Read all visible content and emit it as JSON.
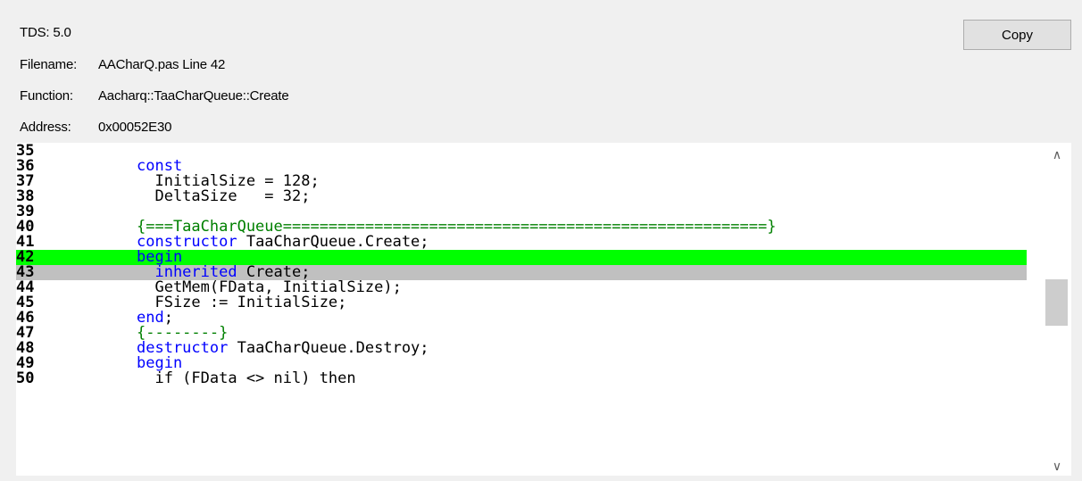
{
  "header": {
    "tds": "TDS: 5.0",
    "filename_label": "Filename:",
    "filename_value": "AACharQ.pas Line 42",
    "function_label": "Function:",
    "function_value": "Aacharq::TaaCharQueue::Create",
    "address_label": "Address:",
    "address_value": "0x00052E30"
  },
  "toolbar": {
    "copy_label": "Copy"
  },
  "code": {
    "highlight_current_line": "42",
    "highlight_secondary_line": "43",
    "colors": {
      "current_line": "#00ff00",
      "secondary_line": "#c0c0c0",
      "keyword": "#0000ff",
      "comment": "#008000"
    },
    "lines": [
      {
        "num": "35",
        "text": ""
      },
      {
        "num": "36",
        "kw1": "const",
        "text": ""
      },
      {
        "num": "37",
        "text": "  InitialSize = 128;"
      },
      {
        "num": "38",
        "text": "  DeltaSize   = 32;"
      },
      {
        "num": "39",
        "text": ""
      },
      {
        "num": "40",
        "comment": "{===TaaCharQueue=====================================================}"
      },
      {
        "num": "41",
        "kw1": "constructor",
        "text": " TaaCharQueue.Create;"
      },
      {
        "num": "42",
        "kw1": "begin",
        "text": ""
      },
      {
        "num": "43",
        "kw1": "  inherited",
        "text": " Create;"
      },
      {
        "num": "44",
        "text": "  GetMem(FData, InitialSize);"
      },
      {
        "num": "45",
        "text": "  FSize := InitialSize;"
      },
      {
        "num": "46",
        "kw1": "end",
        "text": ";"
      },
      {
        "num": "47",
        "comment": "{--------}"
      },
      {
        "num": "48",
        "kw1": "destructor",
        "text": " TaaCharQueue.Destroy;"
      },
      {
        "num": "49",
        "kw1": "begin",
        "text": ""
      },
      {
        "num": "50",
        "text": "  if (FData <> nil) then"
      }
    ]
  },
  "scrollbar": {
    "up_icon": "chevron-up-icon",
    "down_icon": "chevron-down-icon",
    "position": 0.47
  }
}
